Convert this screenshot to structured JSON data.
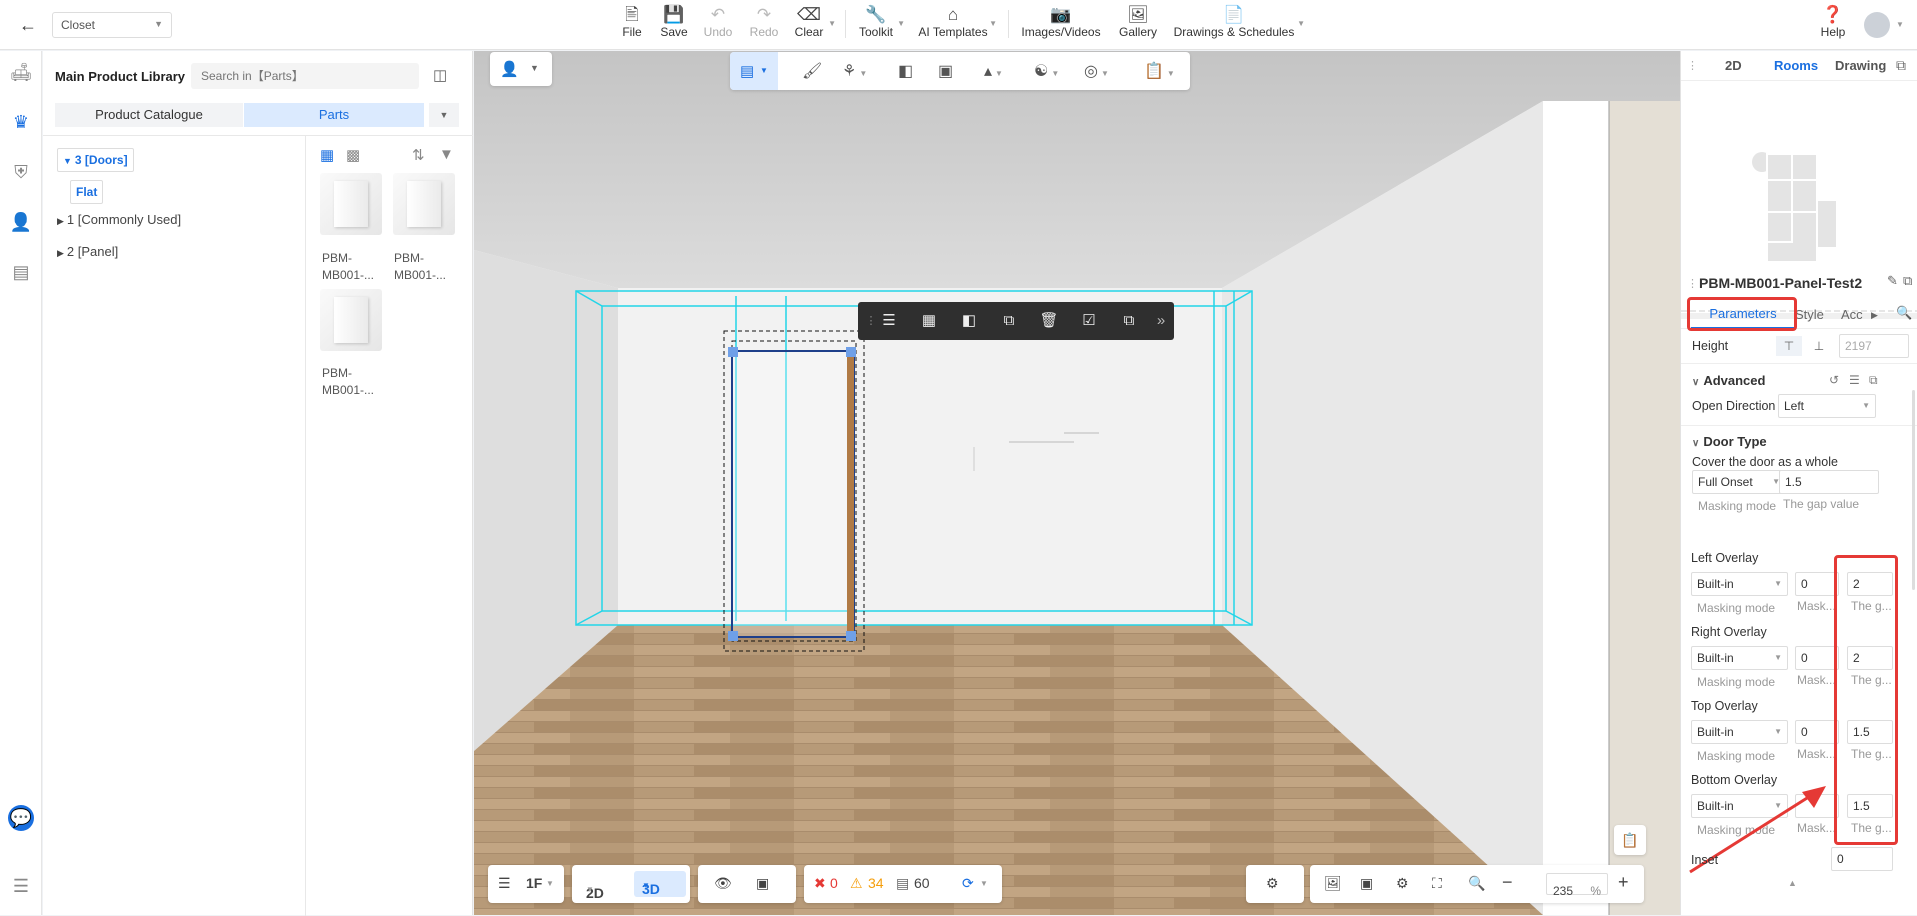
{
  "project": {
    "name": "Closet"
  },
  "toolbar": {
    "file": "File",
    "save": "Save",
    "undo": "Undo",
    "redo": "Redo",
    "clear": "Clear",
    "toolkit": "Toolkit",
    "ai_templates": "AI Templates",
    "images_videos": "Images/Videos",
    "gallery": "Gallery",
    "drawings": "Drawings & Schedules",
    "help": "Help"
  },
  "library": {
    "title": "Main Product Library",
    "search_placeholder": "Search in【Parts】",
    "tab_catalogue": "Product Catalogue",
    "tab_parts": "Parts",
    "tree": [
      {
        "label": "3 [Doors]",
        "expanded": true
      },
      {
        "label": "Flat",
        "selected": true
      },
      {
        "label": "1 [Commonly Used]",
        "expanded": false
      },
      {
        "label": "2 [Panel]",
        "expanded": false
      }
    ],
    "items": [
      {
        "line1": "PBM-",
        "line2": "MB001-..."
      },
      {
        "line1": "PBM-",
        "line2": "MB001-..."
      },
      {
        "line1": "PBM-",
        "line2": "MB001-..."
      }
    ]
  },
  "bottom": {
    "floor": "1F",
    "view2d": "2D",
    "view3d": "3D",
    "errors": "0",
    "warnings": "34",
    "items": "60",
    "zoom": "235",
    "zoom_unit": "%"
  },
  "right": {
    "view_tabs": {
      "t2d": "2D",
      "rooms": "Rooms",
      "drawing": "Drawing"
    },
    "object_title": "PBM-MB001-Panel-Test2",
    "tabs": {
      "parameters": "Parameters",
      "style": "Style",
      "acc": "Acc"
    },
    "height_label": "Height",
    "height_value": "2197",
    "advanced": "Advanced",
    "open_direction_label": "Open Direction",
    "open_direction": "Left",
    "door_type": "Door Type",
    "cover_label": "Cover the door as a whole",
    "cover_mode": "Full Onset",
    "cover_gap": "1.5",
    "masking_mode": "Masking mode",
    "gap_value": "The gap value",
    "mask_short": "Mask...",
    "gap_short": "The g...",
    "overlays": [
      {
        "label": "Left Overlay",
        "mode": "Built-in",
        "mask": "0",
        "gap": "2"
      },
      {
        "label": "Right Overlay",
        "mode": "Built-in",
        "mask": "0",
        "gap": "2"
      },
      {
        "label": "Top Overlay",
        "mode": "Built-in",
        "mask": "0",
        "gap": "1.5"
      },
      {
        "label": "Bottom Overlay",
        "mode": "Built-in",
        "mask": "",
        "gap": "1.5"
      }
    ],
    "inset_label": "Inset",
    "inset_value": "0"
  }
}
